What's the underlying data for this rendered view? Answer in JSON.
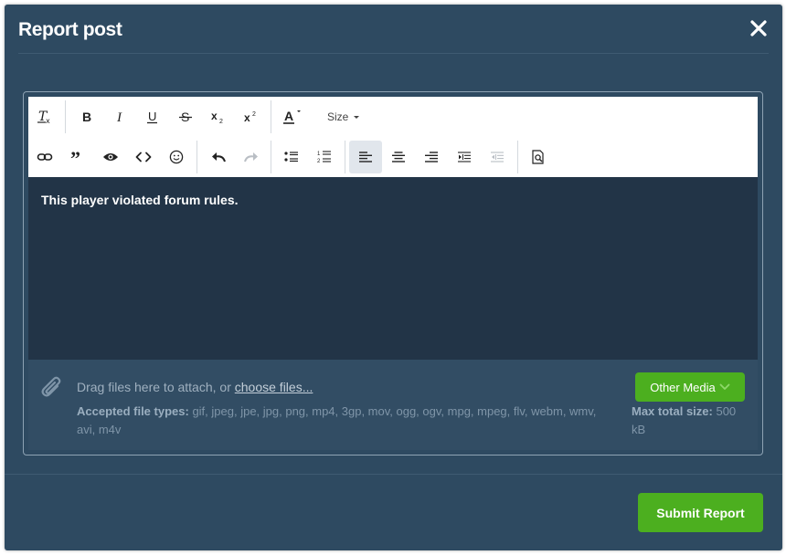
{
  "modal": {
    "title": "Report post",
    "close_icon": "close-icon"
  },
  "toolbar": {
    "size_label": "Size",
    "row1_icons": [
      "clear-format-icon",
      "bold-icon",
      "italic-icon",
      "underline-icon",
      "strikethrough-icon",
      "subscript-icon",
      "superscript-icon",
      "text-color-icon"
    ],
    "row2_icons": [
      "link-icon",
      "quote-icon",
      "spoiler-icon",
      "code-icon",
      "emoji-icon",
      "undo-icon",
      "redo-icon",
      "bullet-list-icon",
      "numbered-list-icon",
      "align-left-icon",
      "align-center-icon",
      "align-right-icon",
      "indent-icon",
      "outdent-icon",
      "preview-icon"
    ],
    "active_item": "align-left-icon"
  },
  "editor": {
    "content": "This player violated forum rules."
  },
  "attachments": {
    "drag_text": "Drag files here to attach, or ",
    "choose_link": "choose files...",
    "accepted_label": "Accepted file types:",
    "accepted_types": " gif, jpeg, jpe, jpg, png, mp4, 3gp, mov, ogg, ogv, mpg, mpeg, flv, webm, wmv, avi, m4v",
    "max_size_label": "Max total size:",
    "max_size_value": " 500 kB",
    "other_media_label": "Other Media"
  },
  "footer": {
    "submit_label": "Submit Report"
  },
  "colors": {
    "modal_bg": "#2e4a61",
    "editor_bg": "#223447",
    "accent_green": "#4caf1f"
  }
}
